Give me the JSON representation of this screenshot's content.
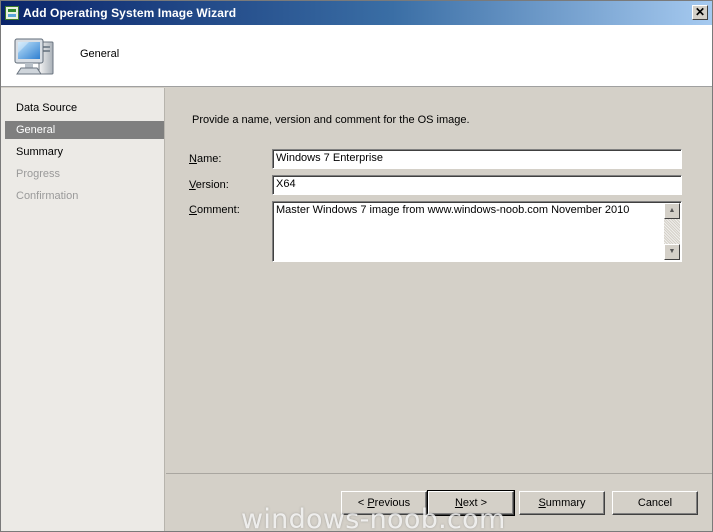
{
  "window": {
    "title": "Add Operating System Image Wizard",
    "close_glyph": "✕"
  },
  "header": {
    "title": "General",
    "icon": "computer-monitor-icon"
  },
  "sidebar": {
    "items": [
      {
        "label": "Data Source",
        "state": "normal"
      },
      {
        "label": "General",
        "state": "active"
      },
      {
        "label": "Summary",
        "state": "normal"
      },
      {
        "label": "Progress",
        "state": "disabled"
      },
      {
        "label": "Confirmation",
        "state": "disabled"
      }
    ]
  },
  "form": {
    "intro": "Provide a name, version and comment for the OS image.",
    "name": {
      "label_prefix": "",
      "label_underlined": "N",
      "label_rest": "ame:",
      "value": "Windows 7 Enterprise"
    },
    "version": {
      "label_prefix": "",
      "label_underlined": "V",
      "label_rest": "ersion:",
      "value": "X64"
    },
    "comment": {
      "label_prefix": "",
      "label_underlined": "C",
      "label_rest": "omment:",
      "value": "Master Windows 7 image from www.windows-noob.com November 2010"
    }
  },
  "footer": {
    "previous": {
      "prefix": "< ",
      "underlined": "P",
      "rest": "revious"
    },
    "next": {
      "prefix": "",
      "underlined": "N",
      "rest": "ext >"
    },
    "summary": {
      "prefix": "",
      "underlined": "S",
      "rest": "ummary"
    },
    "cancel": {
      "label": "Cancel"
    }
  },
  "watermark": "windows-noob.com",
  "colors": {
    "titlebar_start": "#0a246a",
    "titlebar_end": "#a6caf0",
    "active_nav": "#7f7f7f",
    "dialog_face": "#d4d0c8"
  }
}
